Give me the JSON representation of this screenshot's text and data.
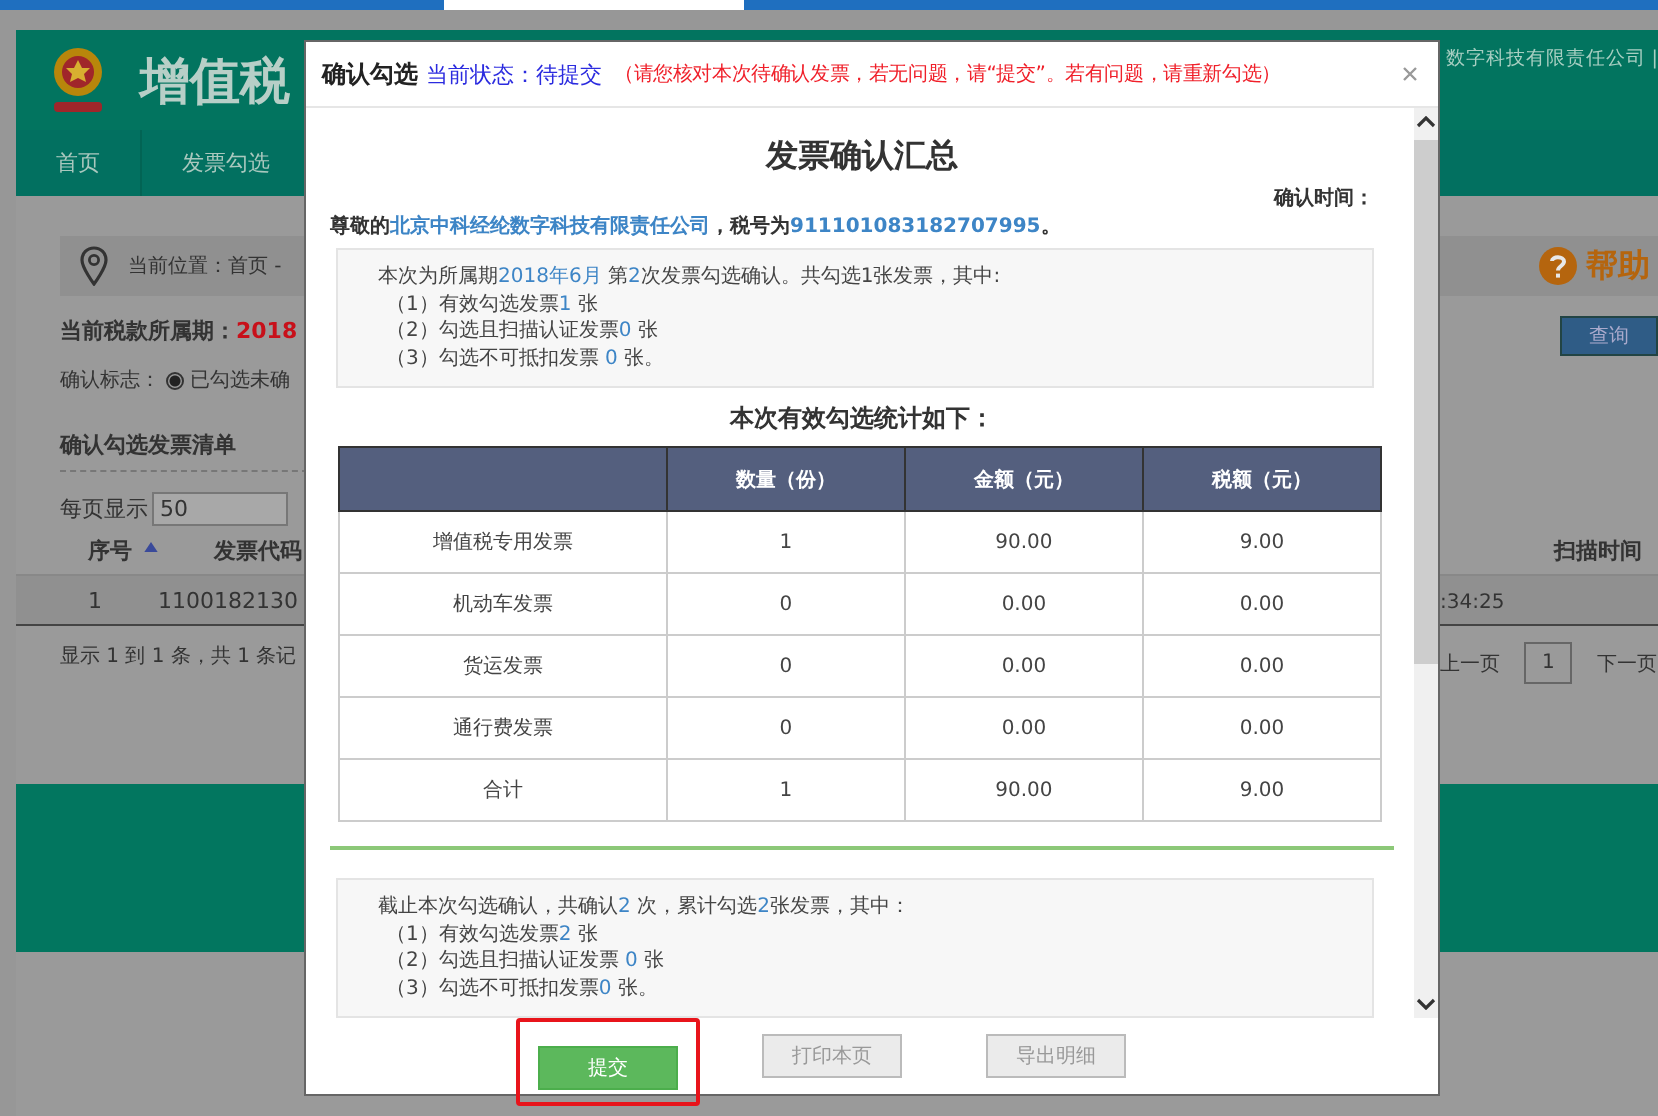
{
  "header": {
    "title": "增值税",
    "account": "数字科技有限责任公司 |"
  },
  "nav": [
    "首页",
    "发票勾选"
  ],
  "location": {
    "text": "当前位置：首页 -",
    "help": "帮助"
  },
  "period": {
    "label": "当前税款所属期：",
    "value": "2018"
  },
  "query_button": "查询",
  "confirm_flag": {
    "label": "确认标志：",
    "option": "已勾选未确",
    "checked": true
  },
  "list_title": "确认勾选发票清单",
  "page_size": {
    "label": "每页显示",
    "value": "50"
  },
  "table": {
    "columns": [
      {
        "label": "序号",
        "sorted": true
      },
      {
        "label": "发票代码",
        "sorted": false
      },
      {
        "label": "扫描时间",
        "sorted": false
      }
    ],
    "rows": [
      [
        "1",
        "1100182130",
        ":34:25"
      ]
    ]
  },
  "summary": "显示 1 到 1 条，共 1 条记",
  "pagination": {
    "prev": "上一页",
    "page": "1",
    "next": "下一页"
  },
  "dialog": {
    "title": "确认勾选",
    "status": "当前状态：待提交",
    "notice": "（请您核对本次待确认发票，若无问题，请“提交”。若有问题，请重新勾选）",
    "heading": "发票确认汇总",
    "confirm_time": "确认时间：",
    "greeting": "尊敬的**北京中科经纶数字科技有限责任公司**，税号为**911101083182707995**。",
    "current_box": [
      [
        {
          "text": "本次为所属期",
          "highlight": false
        },
        {
          "text": "2018年6月",
          "highlight": true
        },
        {
          "text": " 第",
          "highlight": false
        },
        {
          "text": "2",
          "highlight": true
        },
        {
          "text": "次发票勾选确认。共勾选1张发票，其中:",
          "highlight": false
        }
      ],
      [
        {
          "text": "（1）有效勾选发票",
          "highlight": false
        },
        {
          "text": "1",
          "highlight": true
        },
        {
          "text": " 张",
          "highlight": false
        }
      ],
      [
        {
          "text": "（2）勾选且扫描认证发票",
          "highlight": false
        },
        {
          "text": "0",
          "highlight": true
        },
        {
          "text": " 张",
          "highlight": false
        }
      ],
      [
        {
          "text": "（3）勾选不可抵扣发票 ",
          "highlight": false
        },
        {
          "text": "0",
          "highlight": true
        },
        {
          "text": " 张。",
          "highlight": false
        }
      ]
    ],
    "stats_title": "本次有效勾选统计如下：",
    "stats_table": {
      "columns": [
        "",
        "数量（份）",
        "金额（元）",
        "税额（元）"
      ],
      "rows": [
        [
          "增值税专用发票",
          "1",
          "90.00",
          "9.00"
        ],
        [
          "机动车发票",
          "0",
          "0.00",
          "0.00"
        ],
        [
          "货运发票",
          "0",
          "0.00",
          "0.00"
        ],
        [
          "通行费发票",
          "0",
          "0.00",
          "0.00"
        ],
        [
          "合计",
          "1",
          "90.00",
          "9.00"
        ]
      ]
    },
    "cumulative_box": [
      [
        {
          "text": "截止本次勾选确认，共确认",
          "highlight": false
        },
        {
          "text": "2",
          "highlight": true
        },
        {
          "text": " 次，累计勾选",
          "highlight": false
        },
        {
          "text": "2",
          "highlight": true
        },
        {
          "text": "张发票，其中：",
          "highlight": false
        }
      ],
      [
        {
          "text": "（1）有效勾选发票",
          "highlight": false
        },
        {
          "text": "2",
          "highlight": true
        },
        {
          "text": " 张",
          "highlight": false
        }
      ],
      [
        {
          "text": "（2）勾选且扫描认证发票 ",
          "highlight": false
        },
        {
          "text": "0",
          "highlight": true
        },
        {
          "text": " 张",
          "highlight": false
        }
      ],
      [
        {
          "text": "（3）勾选不可抵扣发票",
          "highlight": false
        },
        {
          "text": "0",
          "highlight": true
        },
        {
          "text": " 张。",
          "highlight": false
        }
      ]
    ],
    "buttons": [
      {
        "label": "提交",
        "disabled": false,
        "highlighted": true
      },
      {
        "label": "打印本页",
        "disabled": true,
        "highlighted": false
      },
      {
        "label": "导出明细",
        "disabled": true,
        "highlighted": false
      }
    ]
  }
}
